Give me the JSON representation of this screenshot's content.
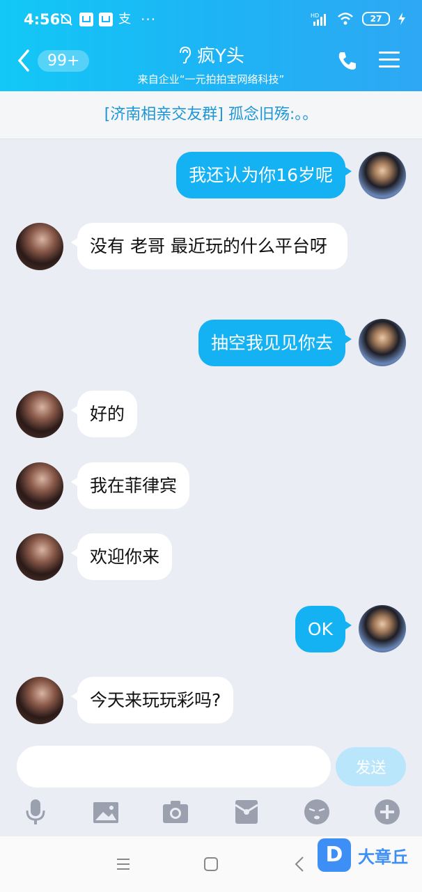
{
  "status_bar": {
    "time": "4:56",
    "char_icon": "支",
    "dots": "···",
    "hd_label": "HD",
    "battery": "27"
  },
  "header": {
    "unread_count": "99+",
    "title": "疯Y头",
    "subtitle": "来自企业“一元拍拍宝网络科技”"
  },
  "notice": {
    "text": "[济南相亲交友群] 孤念旧殇:。。"
  },
  "messages": [
    {
      "side": "out",
      "text": "我还认为你16岁呢"
    },
    {
      "side": "in",
      "text": "没有  老哥  最近玩的什么平台呀"
    },
    {
      "side": "out",
      "text": "抽空我见见你去"
    },
    {
      "side": "in",
      "text": "好的"
    },
    {
      "side": "in",
      "text": "我在菲律宾"
    },
    {
      "side": "in",
      "text": "欢迎你来"
    },
    {
      "side": "out",
      "text": "OK"
    },
    {
      "side": "in",
      "text": "今天来玩玩彩吗?"
    }
  ],
  "composer": {
    "placeholder": "",
    "send_label": "发送"
  },
  "toolbar_icons": [
    "microphone-icon",
    "image-icon",
    "camera-icon",
    "red-packet-icon",
    "emoji-icon",
    "plus-icon"
  ],
  "watermark": {
    "logo_letter": "D",
    "text": "大章丘"
  },
  "colors": {
    "header_gradient_start": "#12c8f6",
    "header_gradient_end": "#2ea8f4",
    "outgoing_bubble": "#14b1f3",
    "incoming_bubble": "#ffffff",
    "chat_background": "#ebedf5",
    "send_button": "#b9e6fb",
    "notice_text": "#1d96d6"
  }
}
